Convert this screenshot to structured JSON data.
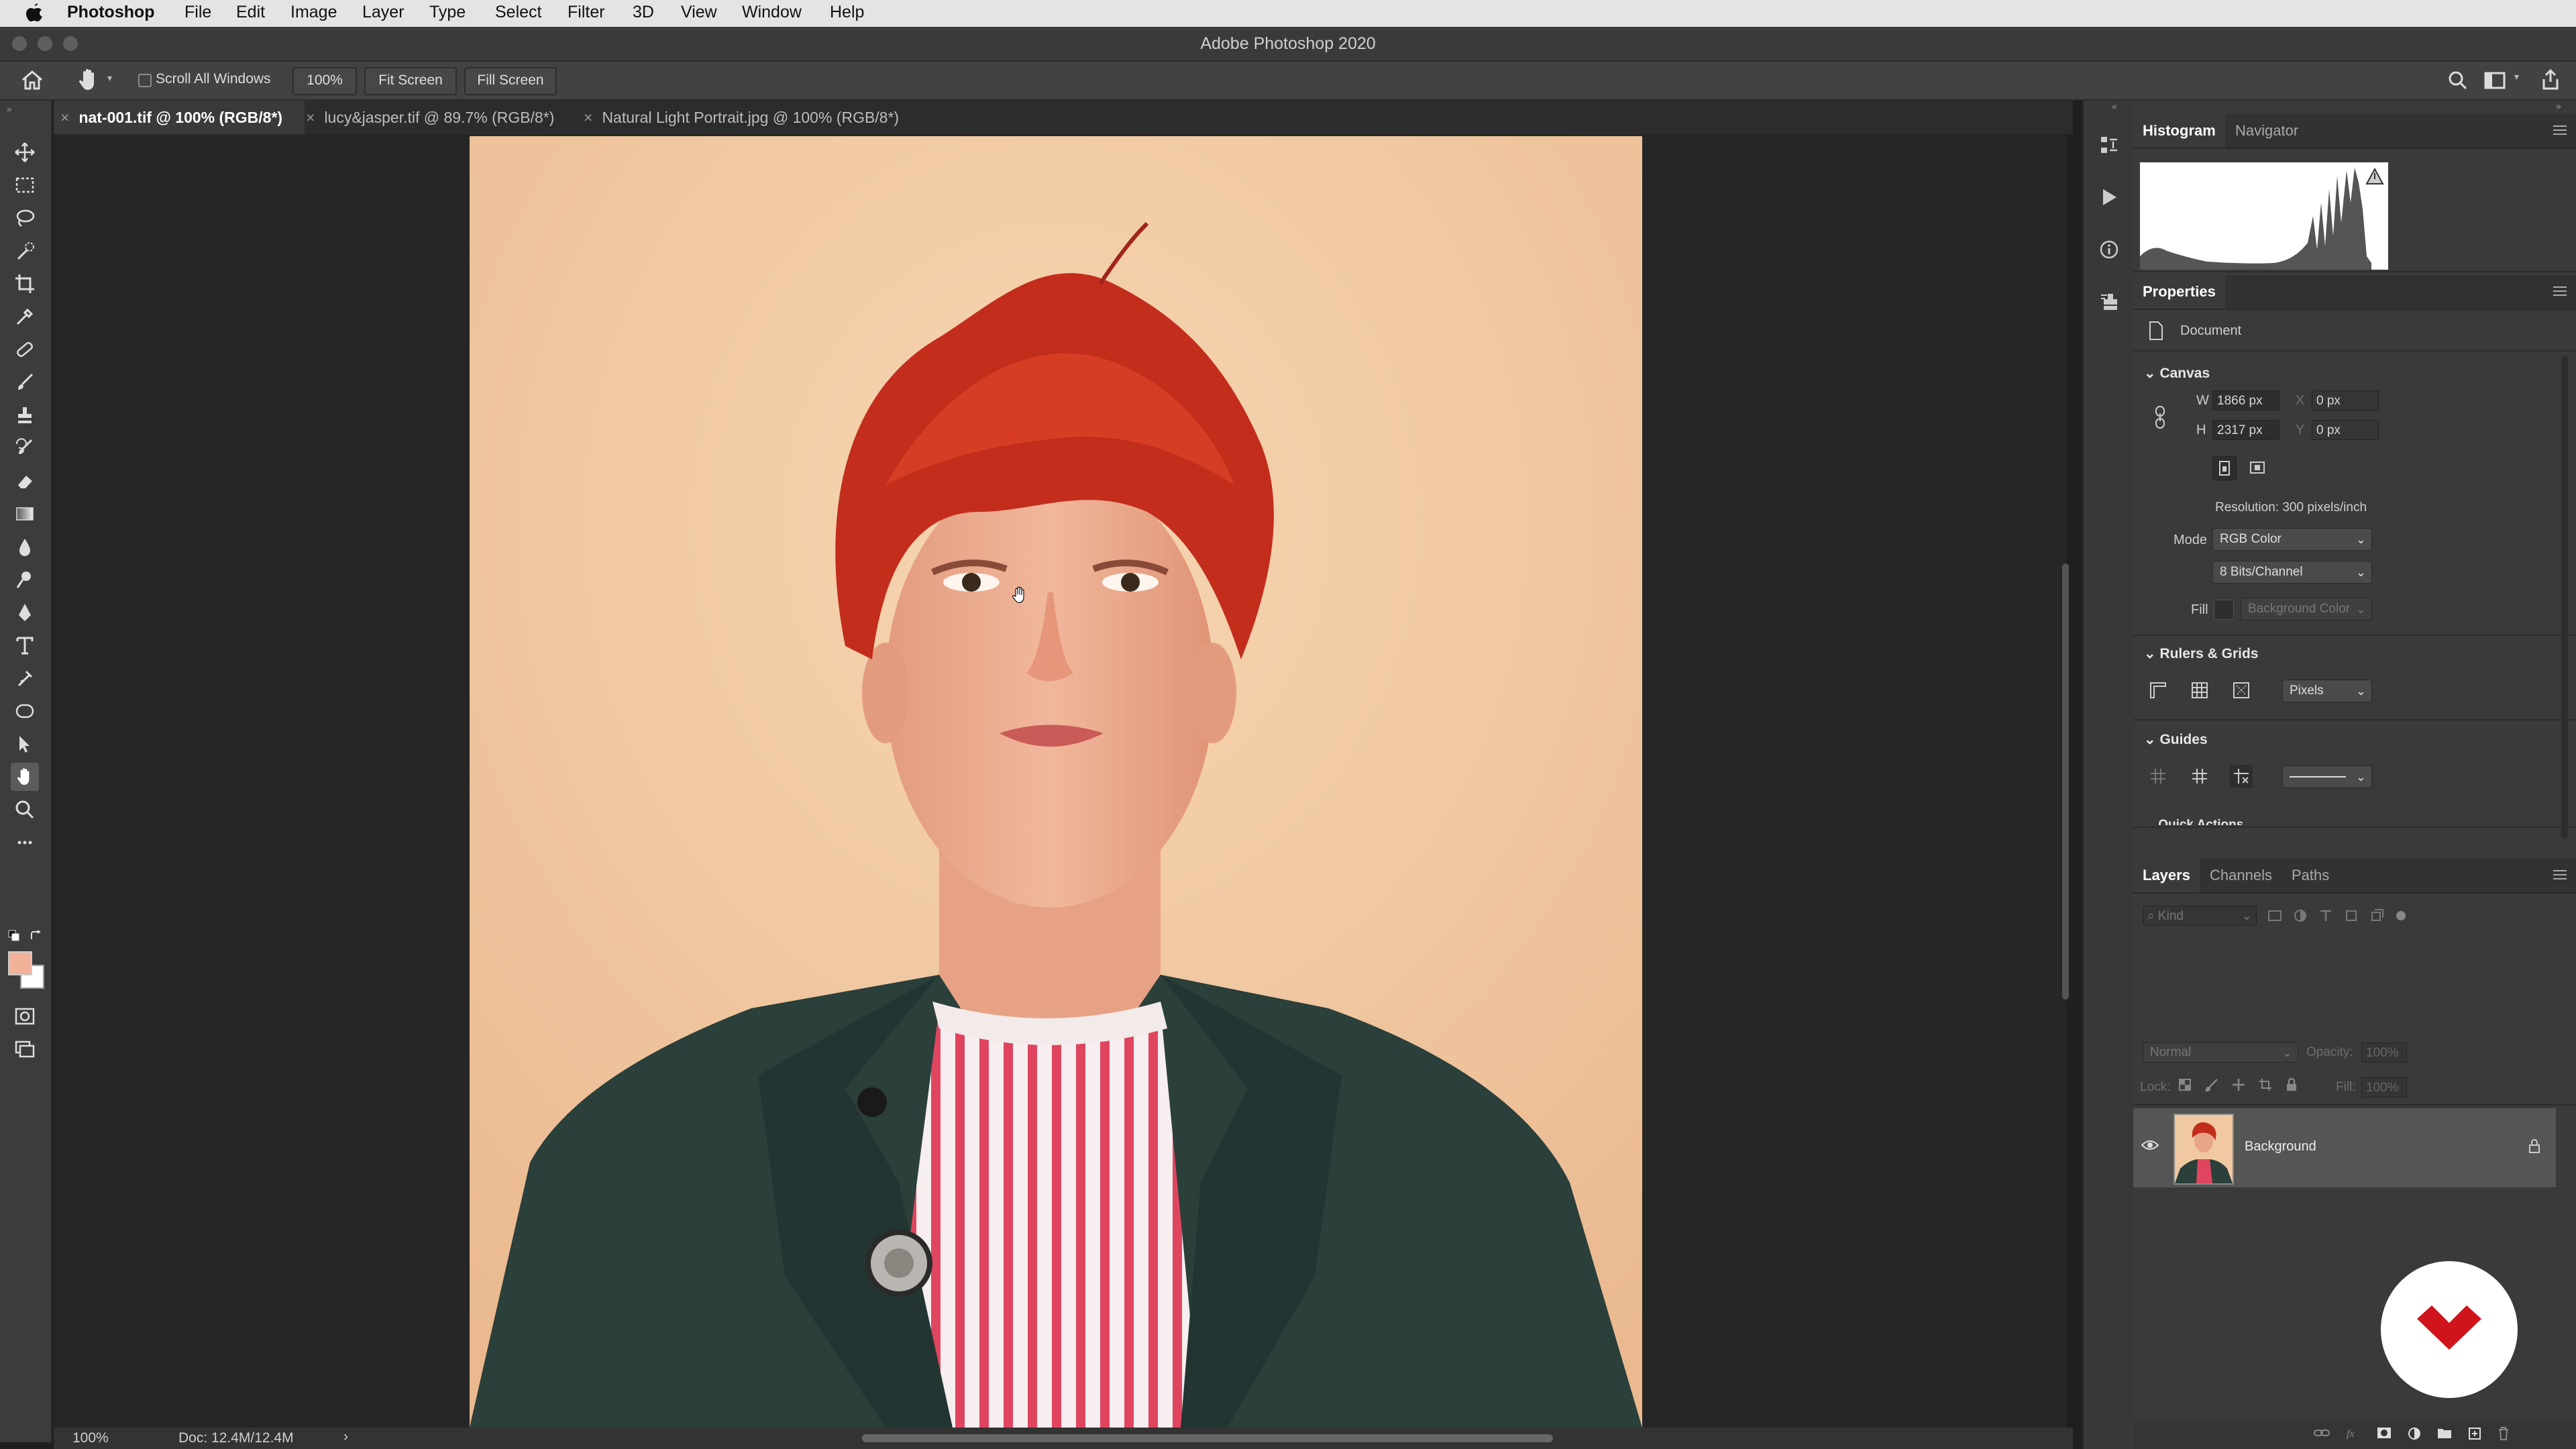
{
  "menubar": {
    "apple_icon": "apple-icon",
    "app_name": "Photoshop",
    "items": [
      "File",
      "Edit",
      "Image",
      "Layer",
      "Type",
      "Select",
      "Filter",
      "3D",
      "View",
      "Window",
      "Help"
    ]
  },
  "window": {
    "title": "Adobe Photoshop 2020"
  },
  "options": {
    "scroll_all_windows": "Scroll All Windows",
    "scroll_all_checked": false,
    "zoom_value": "100%",
    "fit_screen": "Fit Screen",
    "fill_screen": "Fill Screen"
  },
  "tabs": [
    {
      "label": "nat-001.tif @ 100% (RGB/8*)",
      "active": true
    },
    {
      "label": "lucy&jasper.tif @ 89.7% (RGB/8*)",
      "active": false
    },
    {
      "label": "Natural Light Portrait.jpg @ 100% (RGB/8*)",
      "active": false
    }
  ],
  "status": {
    "zoom": "100%",
    "doc": "Doc: 12.4M/12.4M",
    "arrow": "›"
  },
  "panels": {
    "histogram_tabs": [
      "Histogram",
      "Navigator"
    ],
    "properties": {
      "title": "Properties",
      "document_label": "Document",
      "canvas": {
        "title": "Canvas",
        "w_label": "W",
        "w_value": "1866 px",
        "h_label": "H",
        "h_value": "2317 px",
        "x_label": "X",
        "x_value": "0 px",
        "y_label": "Y",
        "y_value": "0 px",
        "resolution": "Resolution: 300 pixels/inch",
        "mode_label": "Mode",
        "mode_value": "RGB Color",
        "bits_value": "8 Bits/Channel",
        "fill_label": "Fill",
        "fill_value": "Background Color"
      },
      "rulers_grids": {
        "title": "Rulers & Grids",
        "units": "Pixels"
      },
      "guides": {
        "title": "Guides"
      },
      "quick_actions": {
        "title": "Quick Actions"
      }
    },
    "layers": {
      "tabs": [
        "Layers",
        "Channels",
        "Paths"
      ],
      "kind_placeholder": "Kind",
      "blend_mode": "Normal",
      "opacity_label": "Opacity:",
      "opacity_value": "100%",
      "lock_label": "Lock:",
      "fill_label": "Fill:",
      "fill_value": "100%",
      "items": [
        {
          "name": "Background",
          "visible": true,
          "locked": true
        }
      ]
    }
  },
  "colors": {
    "foreground": "#f2b29a",
    "background": "#ffffff",
    "canvas_bg": "#f0c9a2",
    "brand_badge": "#d0141c"
  }
}
